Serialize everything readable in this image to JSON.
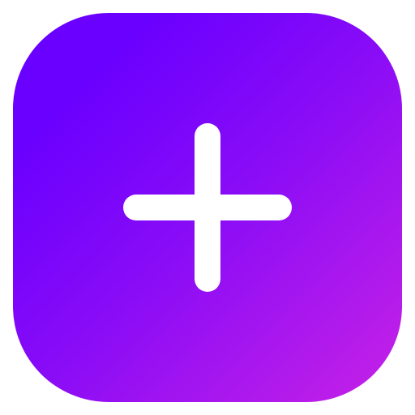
{
  "app_icon": {
    "icon": "plus-icon",
    "colors": {
      "gradient_start": "#6a00ff",
      "gradient_mid": "#8a0cf6",
      "gradient_end": "#c722e6",
      "glyph": "#ffffff"
    }
  }
}
